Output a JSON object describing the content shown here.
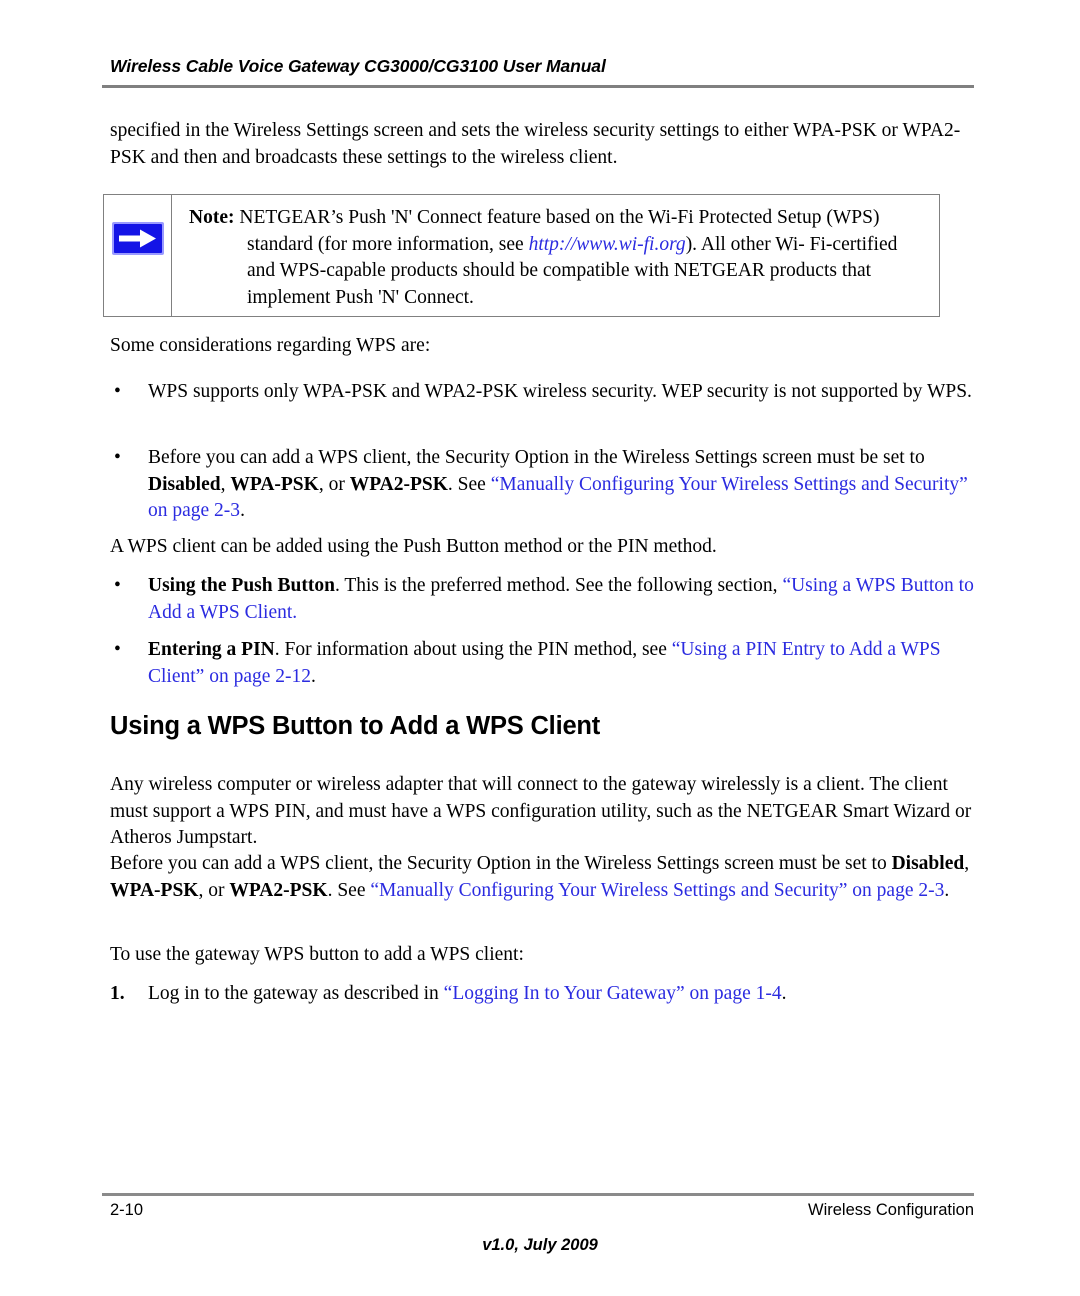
{
  "header": {
    "title": "Wireless Cable Voice Gateway CG3000/CG3100 User Manual"
  },
  "lead_paragraph": "specified in the Wireless Settings screen and sets the wireless security settings to either WPA-PSK or WPA2-PSK and then and broadcasts these settings to the wireless client.",
  "note": {
    "icon": "blue-right-arrow-icon",
    "label": "Note:",
    "line1": "NETGEAR’s Push 'N' Connect feature based on the Wi-Fi Protected Setup",
    "line2_a": "(WPS) standard (for more information, see ",
    "line2_link": "http://www.wi-fi.org",
    "line2_b": "). All other Wi-",
    "line3": "Fi-certified and WPS-capable products should be compatible with NETGEAR",
    "line4": "products that implement Push 'N' Connect."
  },
  "intro_considerations": "Some considerations regarding WPS are:",
  "bullets": [
    {
      "marker": "•",
      "text": "WPS supports only WPA-PSK and WPA2-PSK wireless security. WEP security is not supported by WPS."
    },
    {
      "marker": "•",
      "part1": "Before you can add a WPS client, the Security Option in the Wireless Settings screen must be set to ",
      "bold1": "Disabled",
      "sep1": ", ",
      "bold2": "WPA-PSK",
      "sep2": ", or ",
      "bold3": "WPA2-PSK",
      "part2": ". See ",
      "link": "“Manually Configuring Your Wireless Settings and Security” on page 2-3",
      "part3": "."
    }
  ],
  "method_intro": "A WPS client can be added using the Push Button method or the PIN method.",
  "method_bullets": [
    {
      "marker": "•",
      "bold": "Using the Push Button",
      "text": ". This is the preferred method. See the following section, ",
      "link": "“Using a WPS Button to Add a WPS Client",
      "tail": "."
    },
    {
      "marker": "•",
      "bold": "Entering a PIN",
      "text": ". For information about using the PIN method, see ",
      "link": "“Using a PIN Entry to Add a WPS Client” on page 2-12",
      "tail": "."
    }
  ],
  "section": {
    "heading": "Using a WPS Button to Add a WPS Client",
    "paragraph1": "Any wireless computer or wireless adapter that will connect to the gateway wirelessly is a client. The client must support a WPS PIN, and must have a WPS configuration utility, such as the NETGEAR Smart Wizard or Atheros Jumpstart.",
    "paragraph2": {
      "part1": "Before you can add a WPS client, the Security Option in the Wireless Settings screen must be set to ",
      "bold1": "Disabled",
      "sep1": ", ",
      "bold2": "WPA-PSK",
      "sep2": ", or ",
      "bold3": "WPA2-PSK",
      "part2": ". See ",
      "link": "“Manually Configuring Your Wireless Settings and Security” on page 2-3",
      "part3": "."
    },
    "paragraph3": "To use the gateway WPS button to add a WPS client:",
    "steps": [
      {
        "num": "1.",
        "part1": "Log in to the gateway as described in ",
        "link": "“Logging In to Your Gateway” on page 1-4",
        "part2": "."
      }
    ]
  },
  "footer": {
    "page_number": "2-10",
    "chapter": "Wireless Configuration",
    "version": "v1.0, July 2009"
  },
  "colors": {
    "link": "#2b2be0",
    "rule": "#808080",
    "note_border": "#808080",
    "arrow_blue": "#1414e6"
  }
}
